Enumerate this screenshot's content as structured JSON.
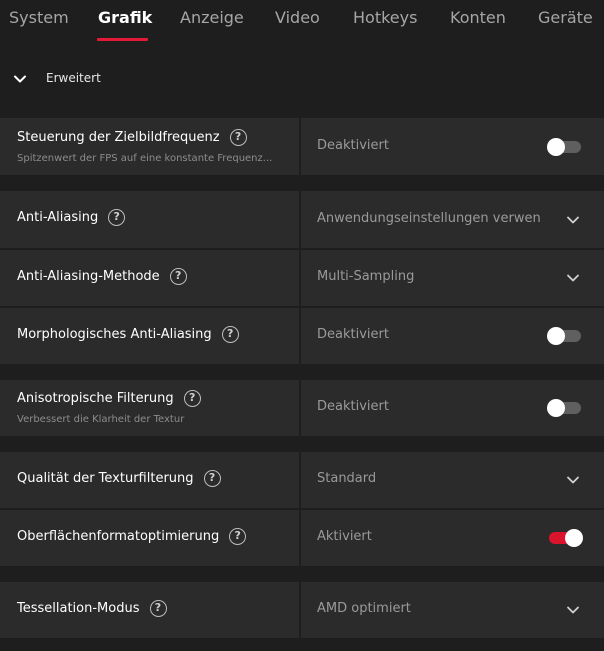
{
  "tabs": [
    {
      "label": "System"
    },
    {
      "label": "Grafik"
    },
    {
      "label": "Anzeige"
    },
    {
      "label": "Video"
    },
    {
      "label": "Hotkeys"
    },
    {
      "label": "Konten"
    },
    {
      "label": "Geräte"
    }
  ],
  "active_tab": "Grafik",
  "section": {
    "label": "Erweitert",
    "icon": "chevron-down-icon"
  },
  "settings": [
    {
      "name": "Steuerung der Zielbildfrequenz",
      "description": "Spitzenwert der FPS auf eine konstante Frequenz...",
      "value": "Deaktiviert",
      "control": "toggle",
      "on": false
    },
    {
      "name": "Anti-Aliasing",
      "value": "Anwendungseinstellungen verwen...",
      "control": "dropdown"
    },
    {
      "name": "Anti-Aliasing-Methode",
      "value": "Multi-Sampling",
      "control": "dropdown"
    },
    {
      "name": "Morphologisches Anti-Aliasing",
      "value": "Deaktiviert",
      "control": "toggle",
      "on": false
    },
    {
      "name": "Anisotropische Filterung",
      "description": "Verbessert die Klarheit der Textur",
      "value": "Deaktiviert",
      "control": "toggle",
      "on": false
    },
    {
      "name": "Qualität der Texturfilterung",
      "value": "Standard",
      "control": "dropdown"
    },
    {
      "name": "Oberflächenformatoptimierung",
      "value": "Aktiviert",
      "control": "toggle",
      "on": true
    },
    {
      "name": "Tessellation-Modus",
      "value": "AMD optimiert",
      "control": "dropdown"
    }
  ],
  "help_glyph": "?",
  "colors": {
    "accent": "#e31937",
    "background": "#1e1e1e",
    "panel": "#2b2b2b",
    "toggle_off": "#5f5f5f",
    "toggle_on": "#d9142c"
  }
}
